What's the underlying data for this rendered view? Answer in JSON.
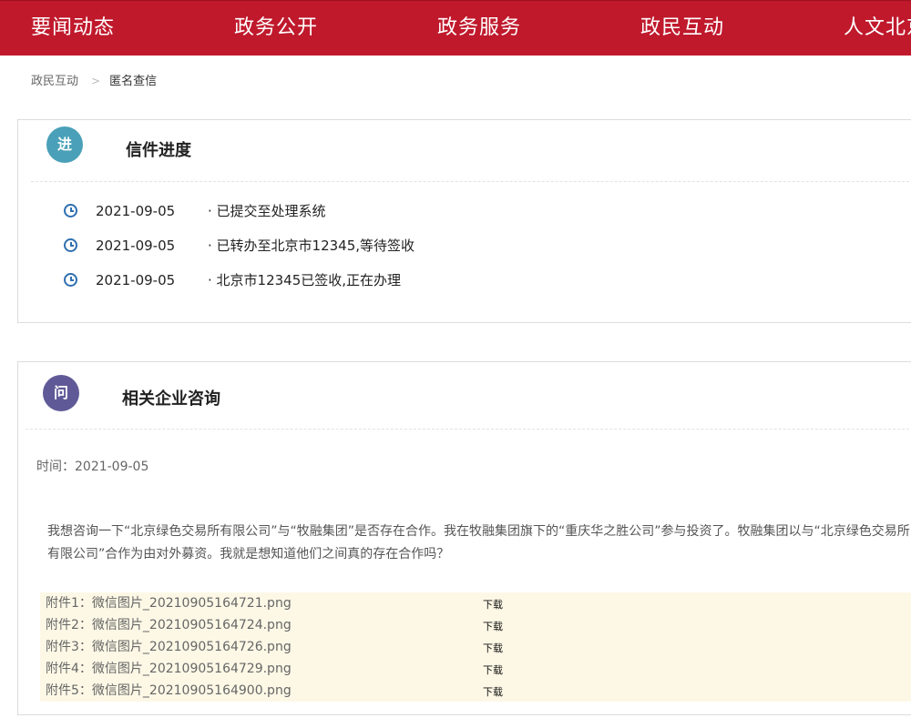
{
  "nav": {
    "items": [
      "要闻动态",
      "政务公开",
      "政务服务",
      "政民互动",
      "人文北京"
    ]
  },
  "breadcrumb": {
    "parent": "政民互动",
    "separator": ">",
    "current": "匿名查信"
  },
  "progress": {
    "badge": "进",
    "title": "信件进度",
    "items": [
      {
        "date": "2021-09-05",
        "text": "· 已提交至处理系统"
      },
      {
        "date": "2021-09-05",
        "text": "· 已转办至北京市12345,等待签收"
      },
      {
        "date": "2021-09-05",
        "text": "· 北京市12345已签收,正在办理"
      }
    ]
  },
  "inquiry": {
    "badge": "问",
    "title": "相关企业咨询",
    "time": "时间：2021-09-05",
    "content": "我想咨询一下“北京绿色交易所有限公司”与“牧融集团”是否存在合作。我在牧融集团旗下的“重庆华之胜公司”参与投资了。牧融集团以与“北京绿色交易所有限公司”合作为由对外募资。我就是想知道他们之间真的存在合作吗？",
    "attachments": [
      {
        "name": "附件1：微信图片_20210905164721.png",
        "download": "下载"
      },
      {
        "name": "附件2：微信图片_20210905164724.png",
        "download": "下载"
      },
      {
        "name": "附件3：微信图片_20210905164726.png",
        "download": "下载"
      },
      {
        "name": "附件4：微信图片_20210905164729.png",
        "download": "下载"
      },
      {
        "name": "附件5：微信图片_20210905164900.png",
        "download": "下载"
      }
    ]
  },
  "colors": {
    "nav_bg": "#c0192c",
    "badge_teal": "#4aa0b8",
    "badge_purple": "#5f5a97",
    "clock_blue": "#2f6fb0",
    "attachment_bg": "#fdf8e6"
  },
  "icons": {
    "timeline": "clock-icon"
  }
}
